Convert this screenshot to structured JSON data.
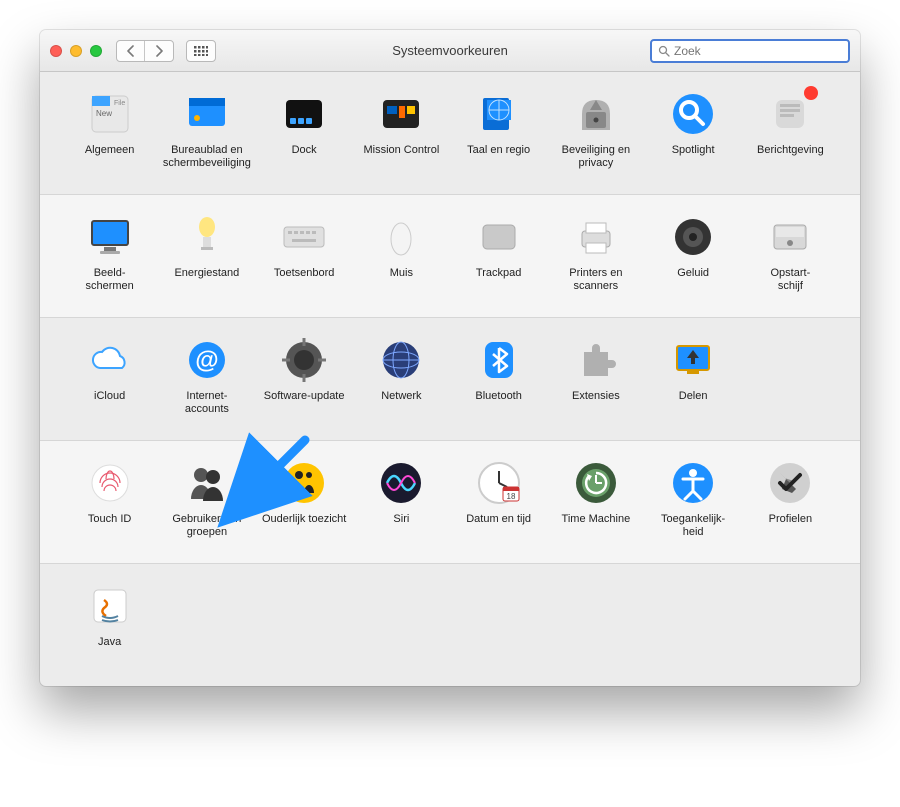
{
  "window_title": "Systeemvoorkeuren",
  "search_placeholder": "Zoek",
  "rows": [
    [
      {
        "id": "algemeen",
        "label": "Algemeen"
      },
      {
        "id": "bureaublad",
        "label": "Bureaublad en schermbeveiliging"
      },
      {
        "id": "dock",
        "label": "Dock"
      },
      {
        "id": "mission",
        "label": "Mission Control"
      },
      {
        "id": "taal",
        "label": "Taal en regio"
      },
      {
        "id": "beveiliging",
        "label": "Beveiliging en privacy"
      },
      {
        "id": "spotlight",
        "label": "Spotlight"
      },
      {
        "id": "berichtgeving",
        "label": "Berichtgeving",
        "badge": true
      }
    ],
    [
      {
        "id": "beeldschermen",
        "label": "Beeld-\nschermen"
      },
      {
        "id": "energie",
        "label": "Energiestand"
      },
      {
        "id": "toetsenbord",
        "label": "Toetsenbord"
      },
      {
        "id": "muis",
        "label": "Muis"
      },
      {
        "id": "trackpad",
        "label": "Trackpad"
      },
      {
        "id": "printers",
        "label": "Printers en scanners"
      },
      {
        "id": "geluid",
        "label": "Geluid"
      },
      {
        "id": "opstart",
        "label": "Opstart-\nschijf"
      }
    ],
    [
      {
        "id": "icloud",
        "label": "iCloud"
      },
      {
        "id": "internet",
        "label": "Internet-\naccounts"
      },
      {
        "id": "software",
        "label": "Software-update"
      },
      {
        "id": "netwerk",
        "label": "Netwerk"
      },
      {
        "id": "bluetooth",
        "label": "Bluetooth"
      },
      {
        "id": "extensies",
        "label": "Extensies"
      },
      {
        "id": "delen",
        "label": "Delen"
      }
    ],
    [
      {
        "id": "touchid",
        "label": "Touch ID"
      },
      {
        "id": "gebruikers",
        "label": "Gebruikers en groepen"
      },
      {
        "id": "ouderlijk",
        "label": "Ouderlijk toezicht"
      },
      {
        "id": "siri",
        "label": "Siri"
      },
      {
        "id": "datum",
        "label": "Datum en tijd"
      },
      {
        "id": "timemachine",
        "label": "Time Machine"
      },
      {
        "id": "toegankelijkheid",
        "label": "Toegankelijk-\nheid"
      },
      {
        "id": "profielen",
        "label": "Profielen"
      }
    ],
    [
      {
        "id": "java",
        "label": "Java"
      }
    ]
  ],
  "annotation_arrow_target": "gebruikers"
}
